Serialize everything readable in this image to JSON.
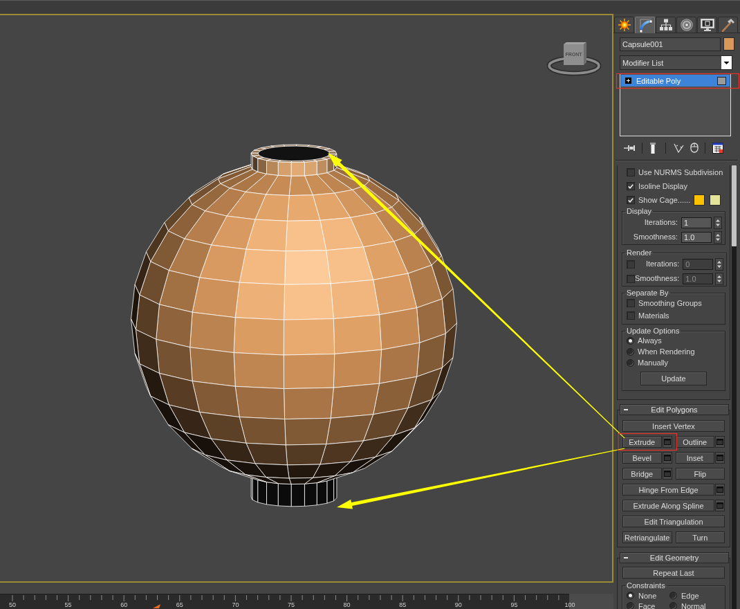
{
  "command_panel": {
    "tabs": [
      {
        "selected": false
      },
      {
        "selected": true
      },
      {
        "selected": false
      },
      {
        "selected": false
      },
      {
        "selected": false
      },
      {
        "selected": false
      }
    ],
    "object_name": {
      "value": "Capsule001",
      "color": "#d8985a"
    },
    "modifier_list": {
      "value": "Modifier List"
    },
    "modifier_stack": [
      {
        "label": "Editable Poly",
        "selected": true,
        "expanded": false
      }
    ],
    "subdivision": {
      "options": [
        {
          "label": "Use NURMS Subdivision",
          "checked": false
        },
        {
          "label": "Isoline Display",
          "checked": true
        },
        {
          "label": "Show Cage......",
          "checked": true,
          "swatches": [
            {
              "color": "#fcc200"
            },
            {
              "color": "#e4e59a"
            }
          ]
        }
      ],
      "display": {
        "title": "Display",
        "spinners": [
          {
            "label": "Iterations:",
            "value": "1",
            "disabled": false
          },
          {
            "label": "Smoothness:",
            "value": "1.0",
            "disabled": false
          }
        ]
      },
      "render": {
        "title": "Render",
        "spinners": [
          {
            "label": "Iterations:",
            "value": "0",
            "checked": false,
            "disabled": true
          },
          {
            "label": "Smoothness:",
            "value": "1.0",
            "checked": false,
            "disabled": true
          }
        ]
      },
      "separate_by": {
        "title": "Separate By",
        "options": [
          {
            "label": "Smoothing Groups",
            "checked": false
          },
          {
            "label": "Materials",
            "checked": false
          }
        ]
      },
      "update_options": {
        "title": "Update Options",
        "options": [
          {
            "label": "Always",
            "selected": true
          },
          {
            "label": "When Rendering",
            "selected": false
          },
          {
            "label": "Manually",
            "selected": false
          }
        ],
        "button": "Update"
      }
    },
    "edit_polygons": {
      "title": "Edit Polygons",
      "expanded": true,
      "rows": [
        [
          {
            "label": "Insert Vertex",
            "settings": false
          }
        ],
        [
          {
            "label": "Extrude",
            "settings": true
          },
          {
            "label": "Outline",
            "settings": true
          }
        ],
        [
          {
            "label": "Bevel",
            "settings": true
          },
          {
            "label": "Inset",
            "settings": true
          }
        ],
        [
          {
            "label": "Bridge",
            "settings": true
          },
          {
            "label": "Flip",
            "settings": false
          }
        ],
        [
          {
            "label": "Hinge From Edge",
            "settings": true
          }
        ],
        [
          {
            "label": "Extrude Along Spline",
            "settings": true
          }
        ],
        [
          {
            "label": "Edit Triangulation",
            "settings": false
          }
        ],
        [
          {
            "label": "Retriangulate",
            "settings": false
          },
          {
            "label": "Turn",
            "settings": false
          }
        ]
      ]
    },
    "edit_geometry": {
      "title": "Edit Geometry",
      "expanded": true,
      "button": "Repeat Last",
      "constraints": {
        "title": "Constraints",
        "options": [
          {
            "label": "None",
            "selected": true
          },
          {
            "label": "Edge",
            "selected": false
          },
          {
            "label": "Face",
            "selected": false
          },
          {
            "label": "Normal",
            "selected": false
          }
        ]
      }
    }
  },
  "viewport": {
    "view_cube": {
      "label": "FRONT"
    }
  },
  "timeline": {
    "labels": [
      "50",
      "55",
      "60",
      "65",
      "70",
      "75",
      "80",
      "85",
      "90",
      "95",
      "100"
    ]
  }
}
